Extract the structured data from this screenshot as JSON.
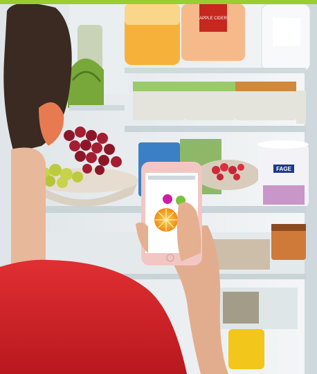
{
  "palette": {
    "accent_bar": "#9acd32",
    "fridge_interior": "#eef1f2",
    "shelf_glass": "#d9e3e6",
    "shirt": "#d8262c",
    "hair": "#3a2a22",
    "skin": "#e7b89a",
    "phone_body": "#f2c7c3"
  },
  "product_labels": {
    "juice_jug": "APPLE CIDER",
    "yogurt_tub": "FAGE"
  },
  "phone_app": {
    "header_text": "",
    "dots": [
      "magenta",
      "green",
      "orange"
    ]
  }
}
